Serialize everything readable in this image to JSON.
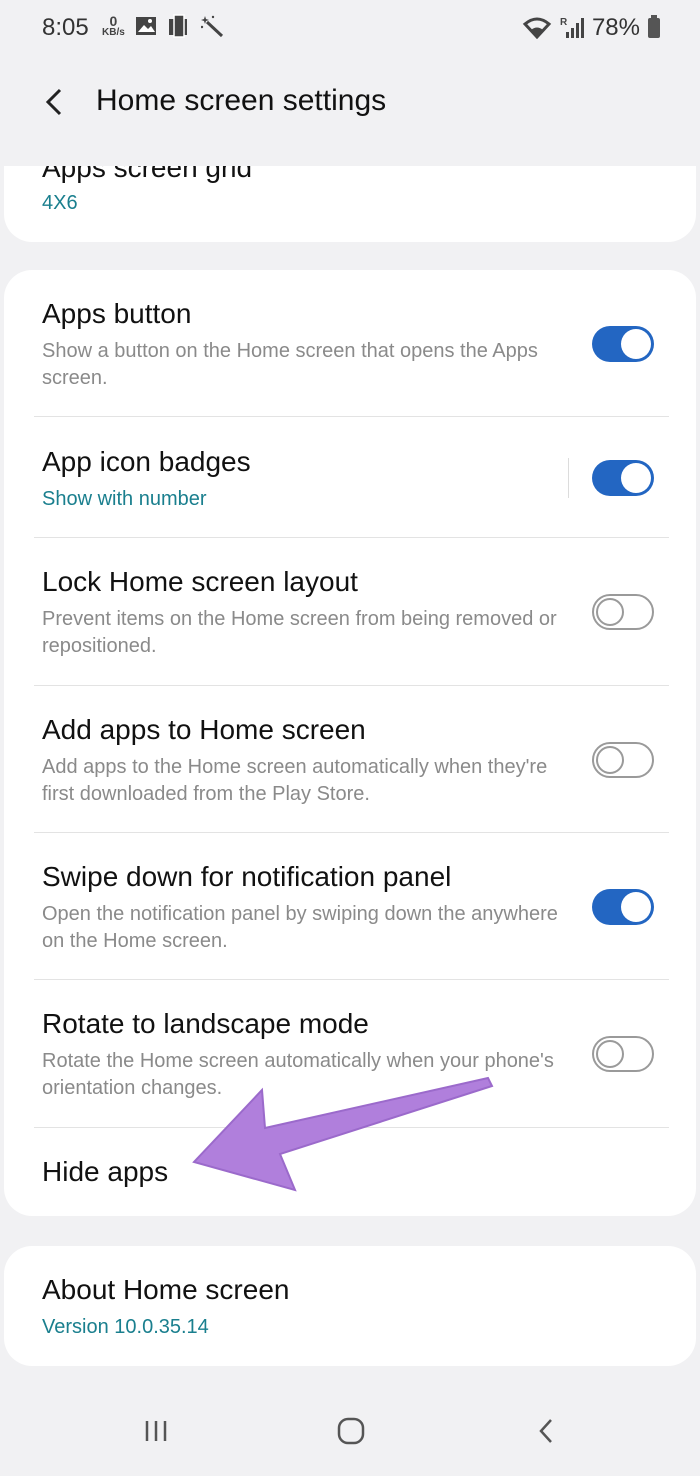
{
  "status_bar": {
    "time": "8:05",
    "data_rate_value": "0",
    "data_rate_unit": "KB/s",
    "battery": "78%",
    "icons": [
      "image-icon",
      "device-icon",
      "wand-icon",
      "wifi-icon",
      "signal-icon",
      "battery-icon"
    ]
  },
  "header": {
    "title": "Home screen settings",
    "back_icon": "chevron-left-icon"
  },
  "top_card": {
    "title": "Apps screen grid",
    "value": "4X6"
  },
  "settings": [
    {
      "title": "Apps button",
      "description": "Show a button on the Home screen that opens the Apps screen.",
      "toggle": true
    },
    {
      "title": "App icon badges",
      "subtitle": "Show with number",
      "toggle": true
    },
    {
      "title": "Lock Home screen layout",
      "description": "Prevent items on the Home screen from being removed or repositioned.",
      "toggle": false
    },
    {
      "title": "Add apps to Home screen",
      "description": "Add apps to the Home screen automatically when they're first downloaded from the Play Store.",
      "toggle": false
    },
    {
      "title": "Swipe down for notification panel",
      "description": "Open the notification panel by swiping down the anywhere on the Home screen.",
      "toggle": true
    },
    {
      "title": "Rotate to landscape mode",
      "description": "Rotate the Home screen automatically when your phone's orientation changes.",
      "toggle": false
    },
    {
      "title": "Hide apps"
    }
  ],
  "about": {
    "title": "About Home screen",
    "version": "Version 10.0.35.14"
  },
  "nav_bar": {
    "icons": [
      "recents-icon",
      "home-icon",
      "back-icon"
    ]
  },
  "colors": {
    "accent": "#2366c2",
    "link_teal": "#1a7f8e",
    "annotation_arrow": "#b07fdc",
    "background": "#f1f1f3"
  }
}
